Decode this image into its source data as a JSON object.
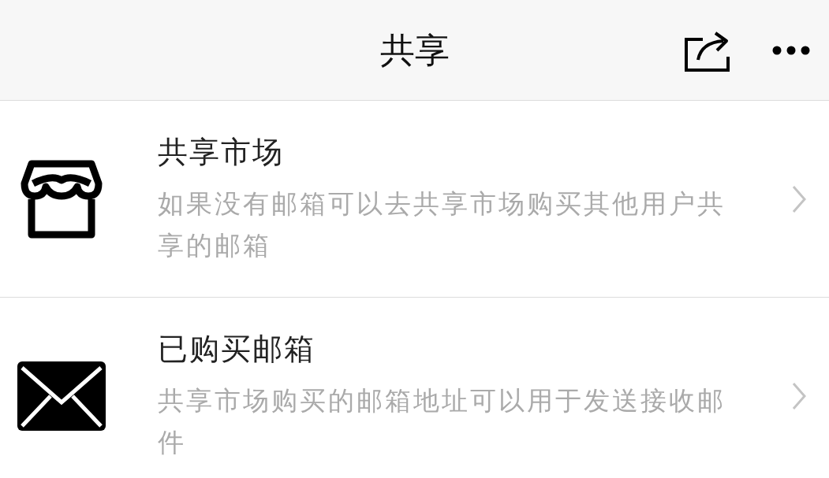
{
  "header": {
    "title": "共享"
  },
  "items": [
    {
      "kind": "store",
      "title": "共享市场",
      "description": "如果没有邮箱可以去共享市场购买其他用户共享的邮箱"
    },
    {
      "kind": "mail",
      "title": "已购买邮箱",
      "description": "共享市场购买的邮箱地址可以用于发送接收邮件"
    }
  ]
}
